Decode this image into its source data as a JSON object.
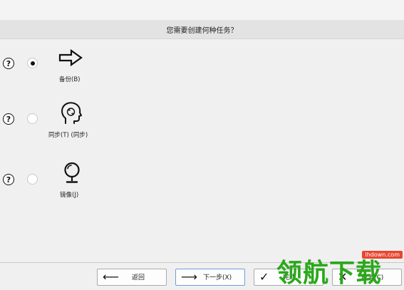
{
  "header": {
    "question": "您需要创建何种任务？"
  },
  "tasks": [
    {
      "label": "备份(B)",
      "selected": true,
      "icon": "arrow-right-outline-icon",
      "help": "?"
    },
    {
      "label": "同步(T) (同步)",
      "selected": false,
      "icon": "head-sync-icon",
      "help": "?"
    },
    {
      "label": "镜像(J)",
      "selected": false,
      "icon": "mirror-icon",
      "help": "?"
    }
  ],
  "footer": {
    "back": {
      "label": "返回",
      "icon": "arrow-left-icon"
    },
    "next": {
      "label": "下一步(X)",
      "icon": "arrow-right-icon"
    },
    "finish": {
      "label": "完成",
      "icon": "check-icon"
    },
    "cancel": {
      "label": "取消(C)",
      "icon": "close-icon"
    }
  },
  "watermark": {
    "url": "lhdown.com",
    "text": "领航下载"
  },
  "colors": {
    "accent": "#6f9fd8",
    "watermark_green": "#2aa81a",
    "watermark_red": "#e94530"
  }
}
